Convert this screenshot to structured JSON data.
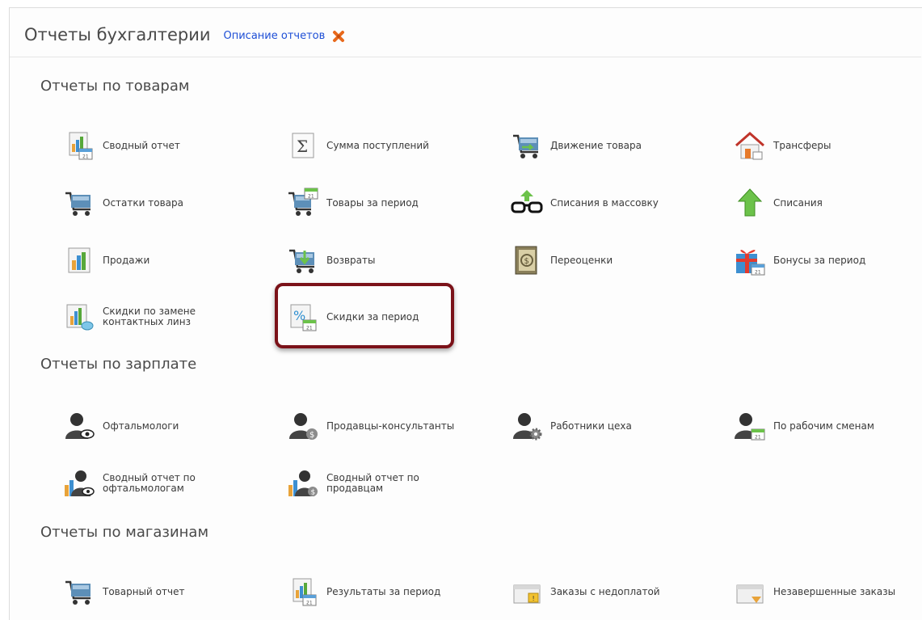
{
  "header": {
    "title": "Отчеты бухгалтерии",
    "desc_link": "Описание отчетов"
  },
  "colors": {
    "accent_red": "#7b1219",
    "link_blue": "#1e4fd6",
    "close_orange": "#e8691c"
  },
  "sections": {
    "goods": {
      "title": "Отчеты по товарам",
      "items": [
        {
          "label": "Сводный отчет",
          "icon": "chart-calendar-icon"
        },
        {
          "label": "Сумма поступлений",
          "icon": "sigma-icon"
        },
        {
          "label": "Движение товара",
          "icon": "cart-arrows-icon"
        },
        {
          "label": "Трансферы",
          "icon": "house-icon"
        },
        {
          "label": "Остатки товара",
          "icon": "cart-icon"
        },
        {
          "label": "Товары за период",
          "icon": "cart-calendar-icon"
        },
        {
          "label": "Списания в массовку",
          "icon": "glasses-arrow-icon"
        },
        {
          "label": "Списания",
          "icon": "green-up-arrow-icon"
        },
        {
          "label": "Продажи",
          "icon": "bar-chart-icon"
        },
        {
          "label": "Возвраты",
          "icon": "cart-return-icon"
        },
        {
          "label": "Переоценки",
          "icon": "ledger-dollar-icon"
        },
        {
          "label": "Бонусы за период",
          "icon": "gift-calendar-icon"
        },
        {
          "label": "Скидки по замене контактных линз",
          "icon": "chart-lens-icon"
        },
        {
          "label": "Скидки за период",
          "icon": "percent-calendar-icon"
        }
      ]
    },
    "salary": {
      "title": "Отчеты по зарплате",
      "items": [
        {
          "label": "Офтальмологи",
          "icon": "user-eye-icon"
        },
        {
          "label": "Продавцы-консультанты",
          "icon": "user-dollar-icon"
        },
        {
          "label": "Работники цеха",
          "icon": "user-gear-icon"
        },
        {
          "label": "По рабочим сменам",
          "icon": "user-calendar-icon"
        },
        {
          "label": "Сводный отчет по офтальмологам",
          "icon": "chart-user-eye-icon"
        },
        {
          "label": "Сводный отчет по продавцам",
          "icon": "chart-user-dollar-icon"
        }
      ]
    },
    "stores": {
      "title": "Отчеты по магазинам",
      "items": [
        {
          "label": "Товарный отчет",
          "icon": "cart-icon"
        },
        {
          "label": "Результаты за период",
          "icon": "chart-calendar-icon"
        },
        {
          "label": "Заказы с недоплатой",
          "icon": "box-warning-icon"
        },
        {
          "label": "Незавершенные заказы",
          "icon": "box-clock-icon"
        }
      ]
    }
  }
}
